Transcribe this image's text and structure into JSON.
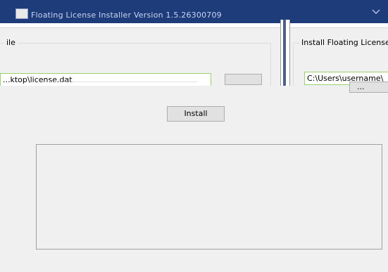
{
  "window": {
    "title": "Floating License Installer  Version 1.5.26300709"
  },
  "left_group": {
    "legend": "ile",
    "file_path": "...ktop\\license.dat"
  },
  "right_group": {
    "legend": "Install Floating License",
    "path_value": "C:\\Users\\username\\",
    "browse_label": "..."
  },
  "actions": {
    "install_label": "Install"
  },
  "log": {
    "content": ""
  }
}
